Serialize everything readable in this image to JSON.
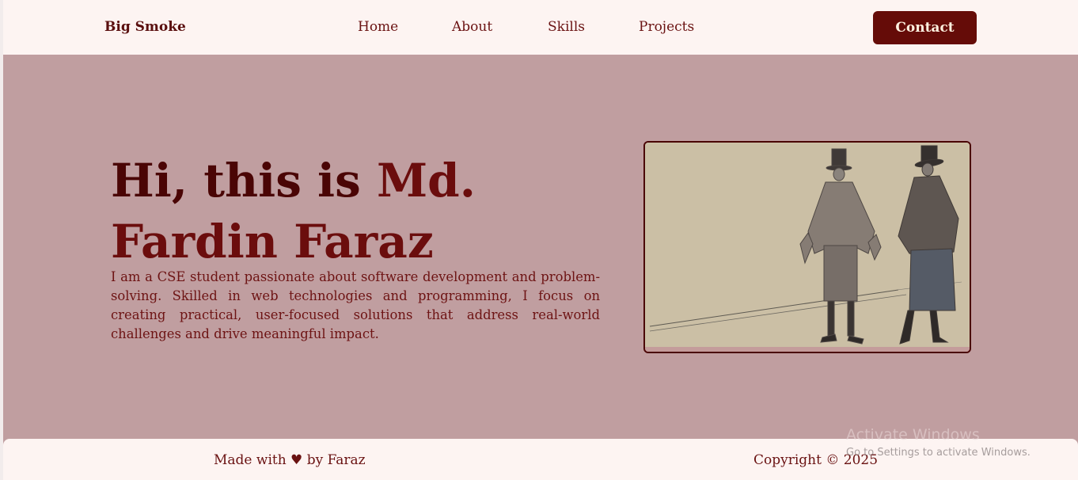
{
  "brand": "Big Smoke",
  "nav": {
    "home": "Home",
    "about": "About",
    "skills": "Skills",
    "projects": "Projects"
  },
  "contact_label": "Contact",
  "hero": {
    "title_prefix": "Hi, this is ",
    "title_name": "Md. Fardin Faraz",
    "description": "I am a CSE student passionate about software development and problem-solving. Skilled in web technologies and programming, I focus on creating practical, user-focused solutions that address real-world challenges and drive meaningful impact."
  },
  "footer": {
    "made_with": "Made with ♥ by Faraz",
    "copyright": "Copyright © 2025"
  },
  "watermark": {
    "title": "Activate Windows",
    "subtitle": "Go to Settings to activate Windows."
  },
  "colors": {
    "primary": "#650c08",
    "hero_bg": "#c09ea0",
    "nav_bg": "#fdf4f2"
  }
}
